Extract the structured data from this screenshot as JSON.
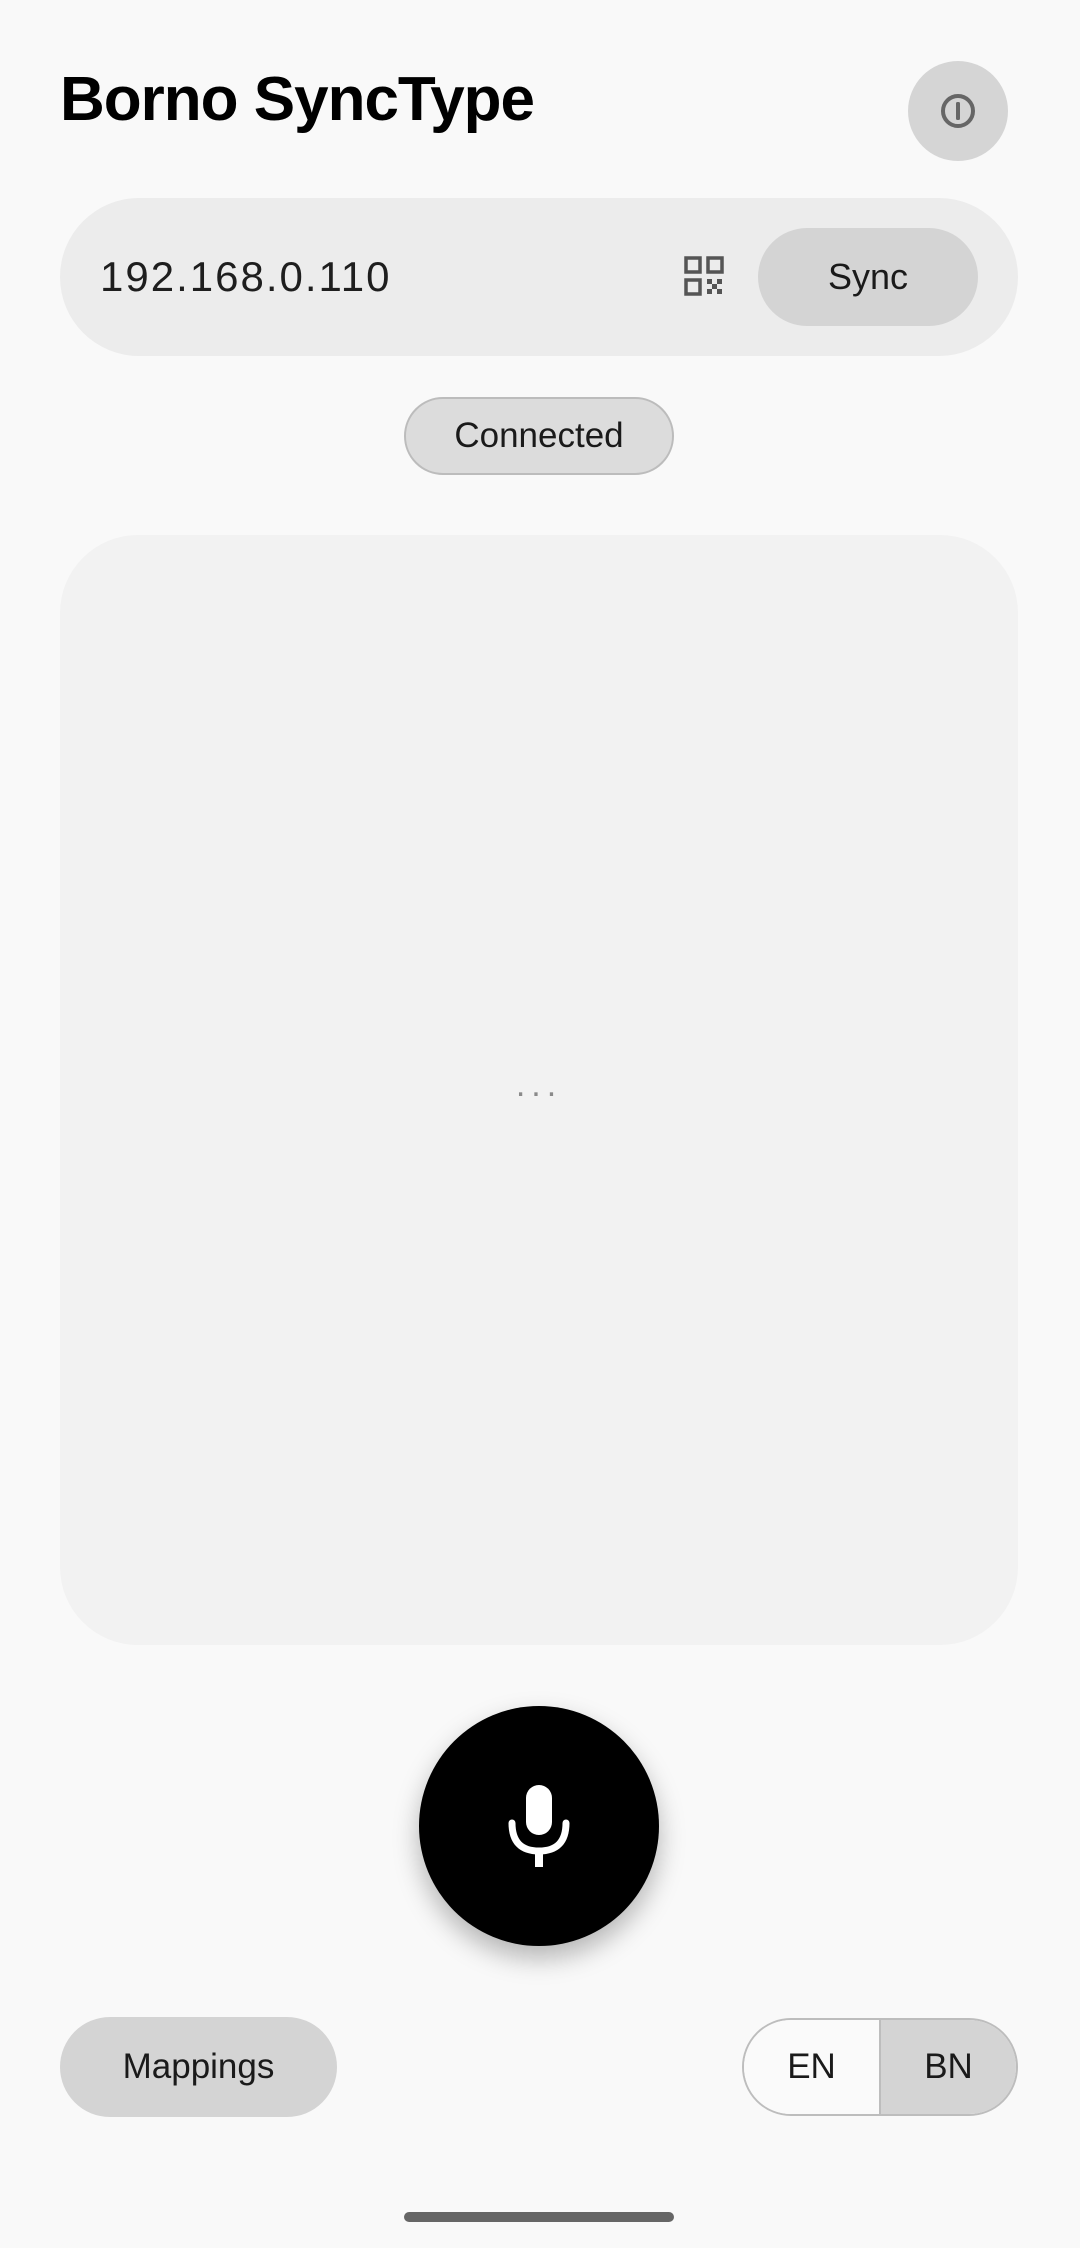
{
  "header": {
    "title": "Borno SyncType",
    "power_icon": "power-icon"
  },
  "connection": {
    "ip_address": "192.168.0.110",
    "qr_icon": "qr-code-icon",
    "sync_label": "Sync",
    "status": "Connected"
  },
  "transcript": {
    "placeholder": "..."
  },
  "controls": {
    "mic_icon": "microphone-icon",
    "mappings_label": "Mappings",
    "languages": [
      "EN",
      "BN"
    ],
    "selected_language": "BN"
  },
  "colors": {
    "background": "#f9f9f9",
    "chip": "#d4d4d4",
    "mic_button": "#000000"
  }
}
